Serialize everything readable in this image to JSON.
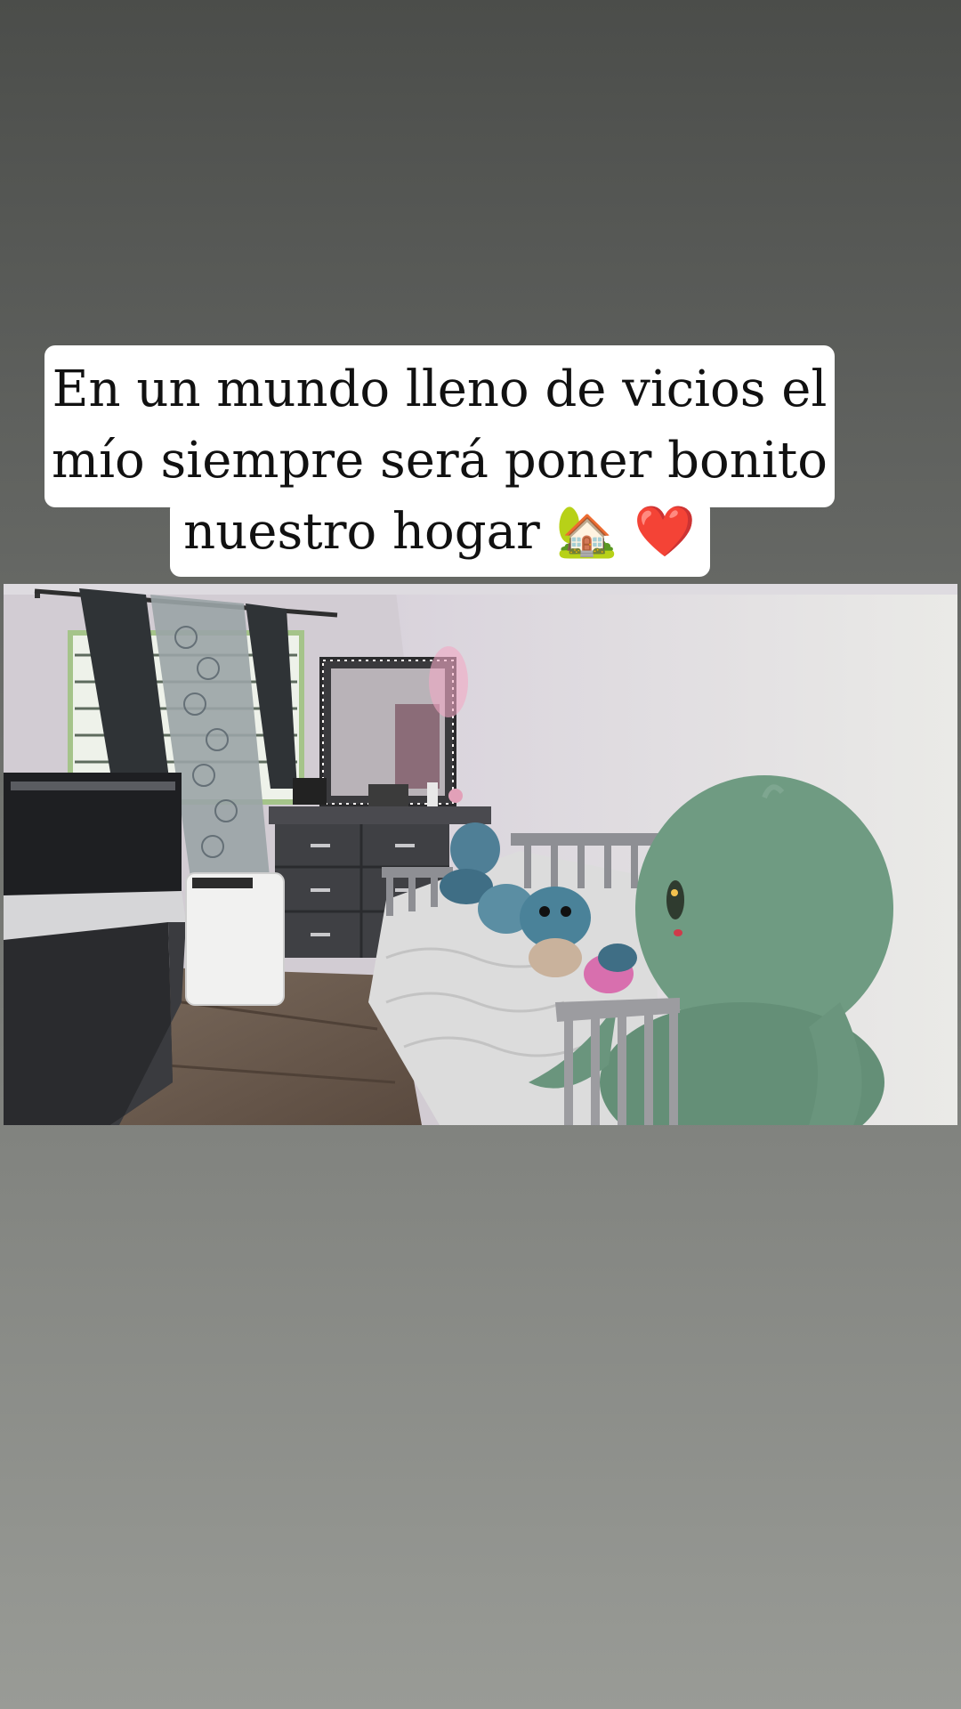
{
  "story": {
    "caption": "En un mundo lleno de vicios el mío siempre será poner bonito nuestro hogar 🏡 ❤️"
  },
  "photo": {
    "subject": "bedroom"
  }
}
